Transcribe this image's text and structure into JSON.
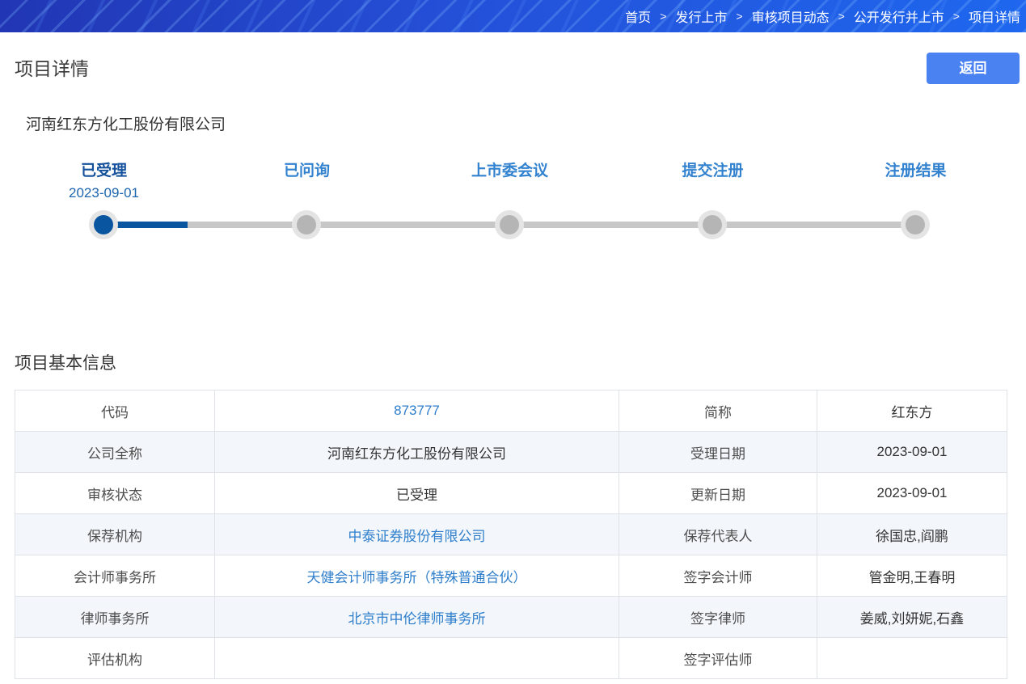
{
  "breadcrumb": {
    "separator": ">",
    "items": [
      "首页",
      "发行上市",
      "审核项目动态",
      "公开发行并上市",
      "项目详情"
    ]
  },
  "page": {
    "title": "项目详情",
    "back_label": "返回",
    "company_name": "河南红东方化工股份有限公司",
    "section_title": "项目基本信息"
  },
  "stepper": {
    "active_step": 0,
    "steps": [
      {
        "label": "已受理",
        "date": "2023-09-01",
        "active": true
      },
      {
        "label": "已问询",
        "date": "",
        "active": false
      },
      {
        "label": "上市委会议",
        "date": "",
        "active": false
      },
      {
        "label": "提交注册",
        "date": "",
        "active": false
      },
      {
        "label": "注册结果",
        "date": "",
        "active": false
      }
    ]
  },
  "table": {
    "rows": [
      {
        "l1": "代码",
        "v1": "873777",
        "l2": "简称",
        "v2": "红东方"
      },
      {
        "l1": "公司全称",
        "v1": "河南红东方化工股份有限公司",
        "l2": "受理日期",
        "v2": "2023-09-01"
      },
      {
        "l1": "审核状态",
        "v1": "已受理",
        "l2": "更新日期",
        "v2": "2023-09-01"
      },
      {
        "l1": "保荐机构",
        "v1": "中泰证券股份有限公司",
        "l2": "保荐代表人",
        "v2": "徐国忠,阎鹏"
      },
      {
        "l1": "会计师事务所",
        "v1": "天健会计师事务所（特殊普通合伙）",
        "l2": "签字会计师",
        "v2": "管金明,王春明"
      },
      {
        "l1": "律师事务所",
        "v1": "北京市中伦律师事务所",
        "l2": "签字律师",
        "v2": "姜威,刘妍妮,石鑫"
      },
      {
        "l1": "评估机构",
        "v1": "",
        "l2": "签字评估师",
        "v2": ""
      }
    ]
  },
  "colors": {
    "header_gradient_left": "#2136b4",
    "header_gradient_right": "#1e67ee",
    "back_button_bg": "#4a83f1",
    "active_step": "#0a55a0",
    "step_label_active": "#15529b",
    "step_label": "#3282cf",
    "step_date": "#1d65ae",
    "track_gray": "#c7c7c7",
    "dot_inactive": "#b5b5b5",
    "link_blue": "#2e7ecb",
    "row_alt_bg": "#f3f7fb",
    "table_border": "#dfe2e6",
    "label_text": "#4d4d4d",
    "value_text": "#333333"
  }
}
